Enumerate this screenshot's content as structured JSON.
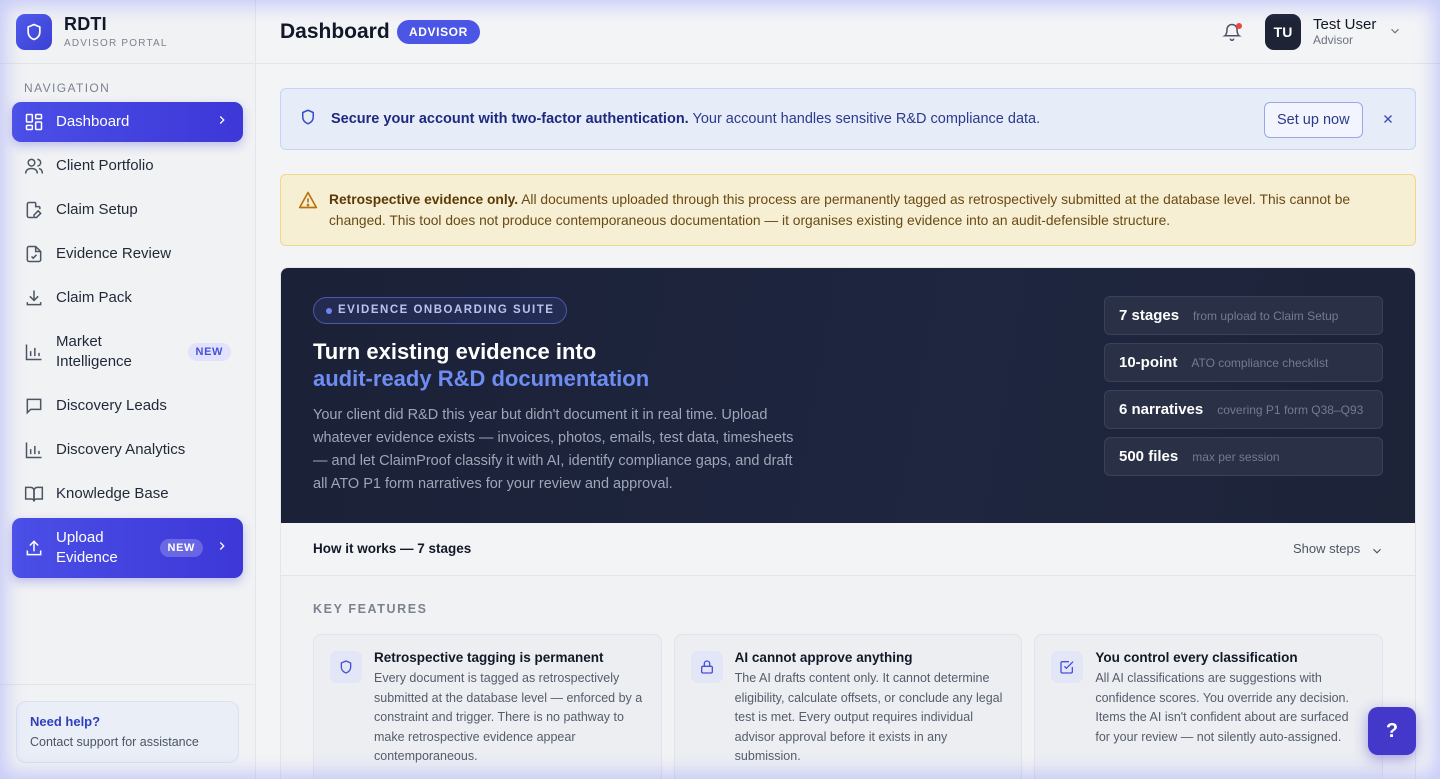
{
  "brand": {
    "title": "RDTI",
    "subtitle": "ADVISOR PORTAL"
  },
  "nav": {
    "heading": "NAVIGATION",
    "items": [
      {
        "label": "Dashboard",
        "icon": "grid-icon",
        "active": true
      },
      {
        "label": "Client Portfolio",
        "icon": "users-icon"
      },
      {
        "label": "Claim Setup",
        "icon": "file-edit-icon"
      },
      {
        "label": "Evidence Review",
        "icon": "file-check-icon"
      },
      {
        "label": "Claim Pack",
        "icon": "download-icon"
      },
      {
        "label": "Market Intelligence",
        "icon": "bar-chart-icon",
        "badge": "NEW"
      },
      {
        "label": "Discovery Leads",
        "icon": "message-square-icon"
      },
      {
        "label": "Discovery Analytics",
        "icon": "bar-chart-icon"
      },
      {
        "label": "Knowledge Base",
        "icon": "book-icon"
      },
      {
        "label": "Upload Evidence",
        "icon": "upload-icon",
        "badge": "NEW",
        "active": true
      }
    ]
  },
  "help": {
    "title": "Need help?",
    "subtitle": "Contact support for assistance"
  },
  "header": {
    "title": "Dashboard",
    "role_badge": "ADVISOR"
  },
  "user": {
    "initials": "TU",
    "name": "Test User",
    "role": "Advisor"
  },
  "banner_2fa": {
    "bold": "Secure your account with two-factor authentication.",
    "text": " Your account handles sensitive R&D compliance data.",
    "button": "Set up now"
  },
  "banner_warning": {
    "bold": "Retrospective evidence only.",
    "text": " All documents uploaded through this process are permanently tagged as retrospectively submitted at the database level. This cannot be changed. This tool does not produce contemporaneous documentation — it organises existing evidence into an audit-defensible structure."
  },
  "onboarding": {
    "pill": "EVIDENCE ONBOARDING SUITE",
    "heading_line1": "Turn existing evidence into",
    "heading_line2": "audit-ready R&D documentation",
    "description": "Your client did R&D this year but didn't document it in real time. Upload whatever evidence exists — invoices, photos, emails, test data, timesheets — and let ClaimProof classify it with AI, identify compliance gaps, and draft all ATO P1 form narratives for your review and approval.",
    "stats": [
      {
        "key": "7 stages",
        "value": "from upload to Claim Setup"
      },
      {
        "key": "10-point",
        "value": "ATO compliance checklist"
      },
      {
        "key": "6 narratives",
        "value": "covering P1 form Q38–Q93"
      },
      {
        "key": "500 files",
        "value": "max per session"
      }
    ],
    "how_title": "How it works — 7 stages",
    "show_steps": "Show steps"
  },
  "features": {
    "title": "KEY FEATURES",
    "cards": [
      {
        "icon": "shield-icon",
        "title": "Retrospective tagging is permanent",
        "text": "Every document is tagged as retrospectively submitted at the database level — enforced by a constraint and trigger. There is no pathway to make retrospective evidence appear contemporaneous."
      },
      {
        "icon": "lock-icon",
        "title": "AI cannot approve anything",
        "text": "The AI drafts content only. It cannot determine eligibility, calculate offsets, or conclude any legal test is met. Every output requires individual advisor approval before it exists in any submission."
      },
      {
        "icon": "check-square-icon",
        "title": "You control every classification",
        "text": "All AI classifications are suggestions with confidence scores. You override any decision. Items the AI isn't confident about are surfaced for your review — not silently auto-assigned."
      }
    ]
  },
  "fab": {
    "label": "?"
  },
  "colors": {
    "accent": "#4a4fe6",
    "warning_bg": "#f7efd4",
    "info_bg": "#e7ecf9",
    "hero_bg": "#1b2136"
  }
}
